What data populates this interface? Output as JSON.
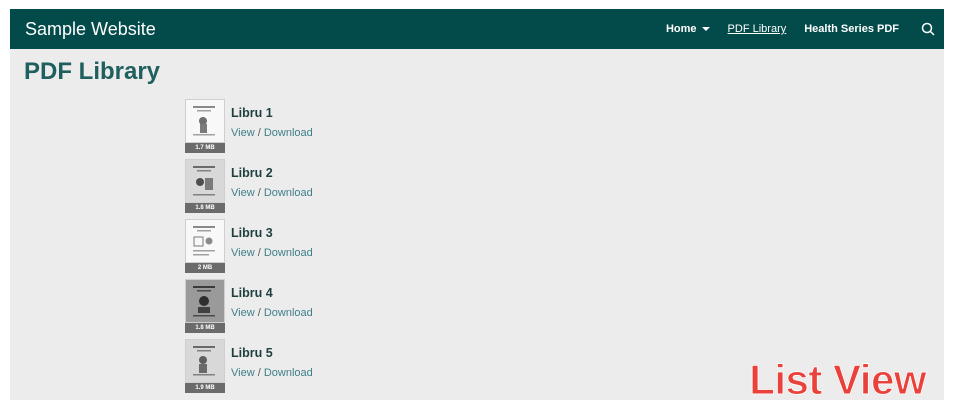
{
  "header": {
    "brand": "Sample Website",
    "nav": [
      {
        "label": "Home",
        "has_dropdown": true
      },
      {
        "label": "PDF Library",
        "active": true
      },
      {
        "label": "Health Series PDF"
      }
    ],
    "search_icon": "search-icon"
  },
  "page": {
    "title": "PDF Library"
  },
  "items": [
    {
      "title": "Libru 1",
      "view": "View",
      "separator": "/",
      "download": "Download",
      "size": "1.7 MB"
    },
    {
      "title": "Libru 2",
      "view": "View",
      "separator": "/",
      "download": "Download",
      "size": "1.8 MB"
    },
    {
      "title": "Libru 3",
      "view": "View",
      "separator": "/",
      "download": "Download",
      "size": "2 MB"
    },
    {
      "title": "Libru 4",
      "view": "View",
      "separator": "/",
      "download": "Download",
      "size": "1.8 MB"
    },
    {
      "title": "Libru 5",
      "view": "View",
      "separator": "/",
      "download": "Download",
      "size": "1.9 MB"
    }
  ],
  "overlay": {
    "label": "List View"
  },
  "colors": {
    "navbar": "#024b4a",
    "title": "#1f5f5e",
    "link": "#3f7f8a",
    "overlay": "#e9423c"
  }
}
